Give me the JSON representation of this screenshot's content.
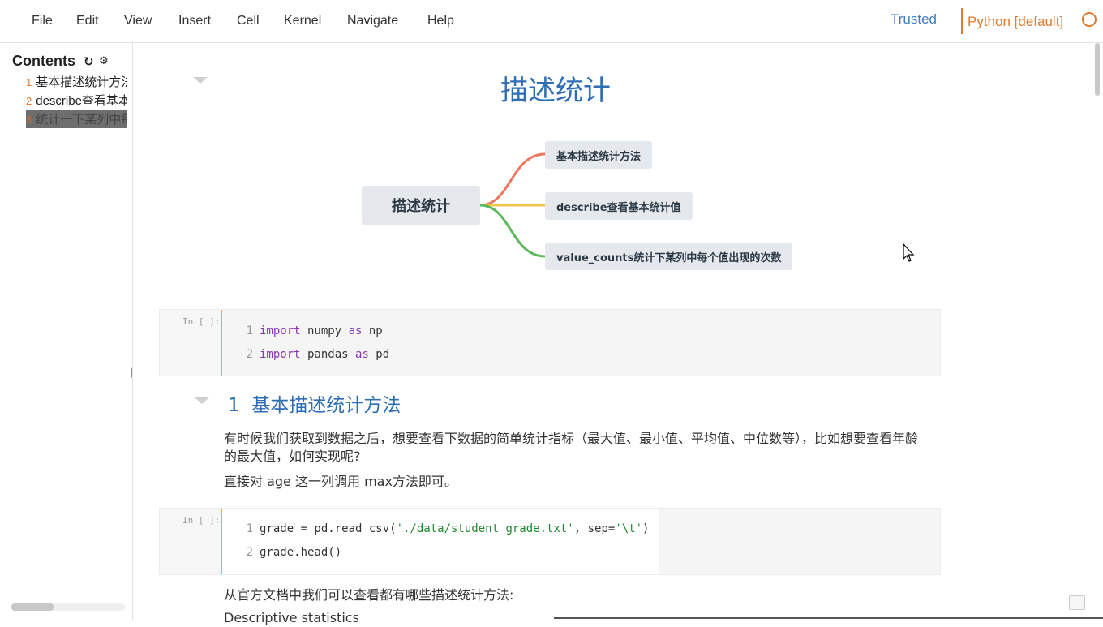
{
  "menu": [
    "File",
    "Edit",
    "View",
    "Insert",
    "Cell",
    "Kernel",
    "Navigate",
    "Help"
  ],
  "status": {
    "trusted": "Trusted",
    "kernel": "Python [default]"
  },
  "toc": {
    "title": "Contents",
    "refresh_icon": "refresh-icon",
    "settings_icon": "gear-icon",
    "items": [
      {
        "num": "1",
        "label": "基本描述统计方法"
      },
      {
        "num": "2",
        "label": "describe查看基本统计值"
      },
      {
        "num": "3",
        "label": "统计一下某列中每个值出现的次数"
      }
    ]
  },
  "notebook": {
    "title": "描述统计",
    "mindmap": {
      "root": "描述统计",
      "branches": [
        {
          "label": "基本描述统计方法",
          "color": "#f07660"
        },
        {
          "label": "describe查看基本统计值",
          "color": "#f0c64a"
        },
        {
          "label": "value_counts统计下某列中每个值出现的次数",
          "color": "#5cb85c"
        }
      ]
    },
    "cell1": {
      "prompt": "In [ ]:",
      "lines": [
        {
          "n": "1",
          "kw1": "import",
          "mod": " numpy ",
          "kw2": "as",
          "alias": " np"
        },
        {
          "n": "2",
          "kw1": "import",
          "mod": " pandas ",
          "kw2": "as",
          "alias": " pd"
        }
      ]
    },
    "section1": {
      "num": "1",
      "title": "基本描述统计方法"
    },
    "para1": "有时候我们获取到数据之后，想要查看下数据的简单统计指标（最大值、最小值、平均值、中位数等），比如想要查看年龄的最大值，如何实现呢?",
    "para2": "直接对 age 这一列调用 max方法即可。",
    "cell2": {
      "prompt": "In [ ]:",
      "line1": {
        "n": "1",
        "pre": "grade = pd.read_csv(",
        "s1": "'./data/student_grade.txt'",
        "mid": ", sep=",
        "s2": "'\\t'",
        "post": ")"
      },
      "line2": {
        "n": "2",
        "text": "grade.head()"
      }
    },
    "para3": "从官方文档中我们可以查看都有哪些描述统计方法:",
    "para4": "Descriptive statistics"
  }
}
